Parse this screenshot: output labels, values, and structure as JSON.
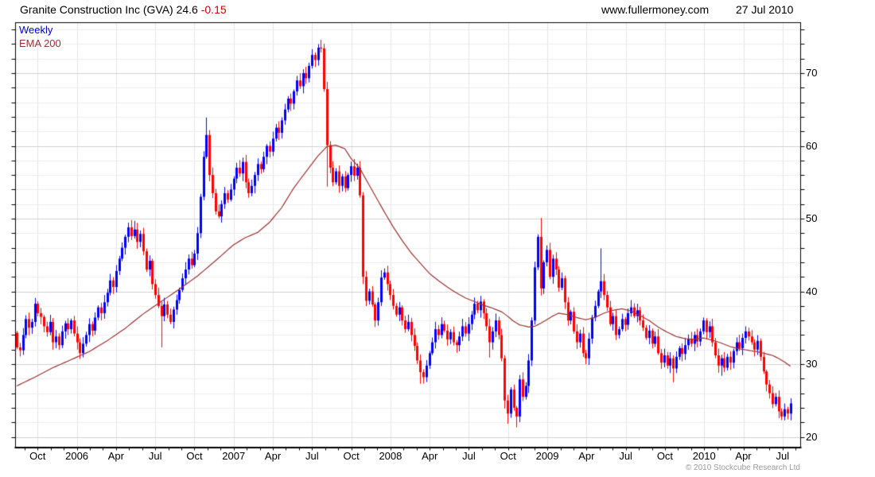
{
  "header": {
    "title": "Granite Construction Inc (GVA) 24.6",
    "change": "-0.15",
    "website": "www.fullermoney.com",
    "date": "27 Jul 2010"
  },
  "legend": {
    "timeframe": "Weekly",
    "overlay": "EMA 200"
  },
  "footer": {
    "copyright": "© 2010 Stockcube Research Ltd"
  },
  "chart_data": {
    "type": "candlestick",
    "title": "Granite Construction Inc (GVA) weekly candles with 200-period EMA",
    "last_price": 24.6,
    "change": -0.15,
    "grid": true,
    "up_color": "#0000ff",
    "down_color": "#ff0000",
    "ema_color": "#993333",
    "x_axis": {
      "start": "Aug 2005",
      "end": "Jul 2010",
      "tick_labels": [
        "Oct",
        "2006",
        "Apr",
        "Jul",
        "Oct",
        "2007",
        "Apr",
        "Jul",
        "Oct",
        "2008",
        "Apr",
        "Jul",
        "Oct",
        "2009",
        "Apr",
        "Jul",
        "Oct",
        "2010",
        "Apr",
        "Jul"
      ]
    },
    "y_axis": {
      "side": "right",
      "tick_labels": [
        "70",
        "60",
        "50",
        "40",
        "30",
        "20"
      ],
      "tick_values": [
        70,
        60,
        50,
        40,
        30,
        20
      ],
      "range": [
        18.6,
        77.0
      ]
    },
    "series": [
      {
        "name": "GVA weekly",
        "first_open": 34.3,
        "closes": [
          32.3,
          31.9,
          34.0,
          36.2,
          35.0,
          35.8,
          38.3,
          37.0,
          36.5,
          35.2,
          34.4,
          35.8,
          33.0,
          33.8,
          32.6,
          34.5,
          35.6,
          34.8,
          36.0,
          34.2,
          33.0,
          31.5,
          32.8,
          34.0,
          35.5,
          34.6,
          36.4,
          37.8,
          37.0,
          38.5,
          39.8,
          41.5,
          40.6,
          42.8,
          44.5,
          46.0,
          47.5,
          48.8,
          47.6,
          48.5,
          46.8,
          47.9,
          45.5,
          43.0,
          44.2,
          41.0,
          39.5,
          38.0,
          36.6,
          38.2,
          36.8,
          35.8,
          37.5,
          38.8,
          40.2,
          41.8,
          43.0,
          44.5,
          43.6,
          45.2,
          48.0,
          53.0,
          58.5,
          61.5,
          56.0,
          53.5,
          51.0,
          50.3,
          52.0,
          53.5,
          52.6,
          54.0,
          55.5,
          57.0,
          56.2,
          57.8,
          55.0,
          53.5,
          54.5,
          56.0,
          57.5,
          56.8,
          58.5,
          60.0,
          59.2,
          61.0,
          62.5,
          61.8,
          63.5,
          65.0,
          66.5,
          65.8,
          67.5,
          69.0,
          68.2,
          70.0,
          69.3,
          71.0,
          72.5,
          71.8,
          73.5,
          73.4,
          67.8,
          60.1,
          57.0,
          55.0,
          56.5,
          54.5,
          55.8,
          54.2,
          56.0,
          57.2,
          55.9,
          57.0,
          53.2,
          42.0,
          38.7,
          40.0,
          38.2,
          36.0,
          38.5,
          41.9,
          42.6,
          41.0,
          39.5,
          38.0,
          36.8,
          37.8,
          36.0,
          34.8,
          35.8,
          34.0,
          32.5,
          30.5,
          28.9,
          28.2,
          29.8,
          31.5,
          33.0,
          34.8,
          34.0,
          35.5,
          34.6,
          33.4,
          34.4,
          33.0,
          32.6,
          33.8,
          35.2,
          34.2,
          35.5,
          36.8,
          38.3,
          37.4,
          38.6,
          37.0,
          35.2,
          33.0,
          34.5,
          36.0,
          34.0,
          30.8,
          25.0,
          23.2,
          26.5,
          24.0,
          22.8,
          27.9,
          25.5,
          27.0,
          30.5,
          36.0,
          43.3,
          47.5,
          40.4,
          44.0,
          45.7,
          42.0,
          44.5,
          43.0,
          40.5,
          41.8,
          38.5,
          36.0,
          37.2,
          34.5,
          33.0,
          34.2,
          31.5,
          30.8,
          33.5,
          36.4,
          38.0,
          40.0,
          41.4,
          39.5,
          37.8,
          35.5,
          36.6,
          34.0,
          34.8,
          36.2,
          35.4,
          37.0,
          37.8,
          36.6,
          37.4,
          36.0,
          35.0,
          33.6,
          34.6,
          32.8,
          33.8,
          31.5,
          30.2,
          31.2,
          29.8,
          30.8,
          29.4,
          31.0,
          32.2,
          31.4,
          32.6,
          33.5,
          32.8,
          34.0,
          33.1,
          34.5,
          36.0,
          34.4,
          35.2,
          33.0,
          31.2,
          29.8,
          30.8,
          29.5,
          31.0,
          30.2,
          31.8,
          33.0,
          32.2,
          33.6,
          34.5,
          33.8,
          33.0,
          32.0,
          33.2,
          31.0,
          29.0,
          27.2,
          26.0,
          24.5,
          25.5,
          23.5,
          22.8,
          23.8,
          23.2,
          24.6
        ],
        "wick_overrides": {
          "39": [
            49.7,
            null
          ],
          "48": [
            null,
            32.3
          ],
          "63": [
            63.9,
            null
          ],
          "100": [
            74.0,
            null
          ],
          "101": [
            74.6,
            null
          ],
          "103": [
            null,
            54.4
          ],
          "115": [
            null,
            41.0
          ],
          "134": [
            null,
            27.3
          ],
          "157": [
            null,
            30.9
          ],
          "162": [
            null,
            23.9
          ],
          "163": [
            null,
            21.8
          ],
          "166": [
            null,
            21.3
          ],
          "174": [
            50.1,
            null
          ],
          "189": [
            null,
            30.0
          ],
          "194": [
            45.9,
            null
          ],
          "218": [
            null,
            27.5
          ],
          "228": [
            36.4,
            null
          ],
          "234": [
            null,
            28.4
          ],
          "242": [
            35.2,
            null
          ],
          "254": [
            null,
            22.3
          ],
          "256": [
            null,
            22.4
          ]
        }
      },
      {
        "name": "EMA 200",
        "points": [
          [
            0,
            27.0
          ],
          [
            6,
            28.2
          ],
          [
            12,
            29.5
          ],
          [
            18,
            30.6
          ],
          [
            24,
            31.7
          ],
          [
            30,
            33.2
          ],
          [
            36,
            34.9
          ],
          [
            42,
            36.9
          ],
          [
            48,
            38.6
          ],
          [
            54,
            40.3
          ],
          [
            60,
            42.1
          ],
          [
            66,
            44.2
          ],
          [
            72,
            46.4
          ],
          [
            76,
            47.4
          ],
          [
            80,
            48.1
          ],
          [
            84,
            49.5
          ],
          [
            88,
            51.5
          ],
          [
            92,
            54.2
          ],
          [
            96,
            56.4
          ],
          [
            100,
            58.6
          ],
          [
            103,
            59.9
          ],
          [
            106,
            60.1
          ],
          [
            109,
            59.6
          ],
          [
            111,
            58.3
          ],
          [
            114,
            56.9
          ],
          [
            116,
            55.4
          ],
          [
            119,
            53.2
          ],
          [
            122,
            51.0
          ],
          [
            125,
            48.9
          ],
          [
            128,
            47.0
          ],
          [
            131,
            45.3
          ],
          [
            134,
            43.9
          ],
          [
            137,
            42.5
          ],
          [
            140,
            41.5
          ],
          [
            143,
            40.6
          ],
          [
            146,
            39.8
          ],
          [
            149,
            39.1
          ],
          [
            152,
            38.6
          ],
          [
            155,
            38.1
          ],
          [
            158,
            37.7
          ],
          [
            161,
            37.2
          ],
          [
            163,
            36.6
          ],
          [
            165,
            35.9
          ],
          [
            167,
            35.4
          ],
          [
            170,
            35.1
          ],
          [
            172,
            35.2
          ],
          [
            174,
            35.6
          ],
          [
            176,
            36.1
          ],
          [
            178,
            36.6
          ],
          [
            180,
            37.0
          ],
          [
            183,
            36.8
          ],
          [
            186,
            36.4
          ],
          [
            189,
            36.1
          ],
          [
            192,
            36.4
          ],
          [
            195,
            37.0
          ],
          [
            198,
            37.4
          ],
          [
            201,
            37.6
          ],
          [
            204,
            37.3
          ],
          [
            207,
            36.7
          ],
          [
            210,
            36.0
          ],
          [
            213,
            35.1
          ],
          [
            216,
            34.4
          ],
          [
            219,
            33.8
          ],
          [
            222,
            33.5
          ],
          [
            225,
            33.4
          ],
          [
            228,
            33.6
          ],
          [
            231,
            33.3
          ],
          [
            234,
            32.9
          ],
          [
            237,
            32.4
          ],
          [
            240,
            32.1
          ],
          [
            243,
            31.9
          ],
          [
            246,
            31.7
          ],
          [
            249,
            31.4
          ],
          [
            251,
            31.2
          ],
          [
            253,
            30.8
          ],
          [
            255,
            30.3
          ],
          [
            257,
            29.7
          ]
        ]
      }
    ]
  }
}
